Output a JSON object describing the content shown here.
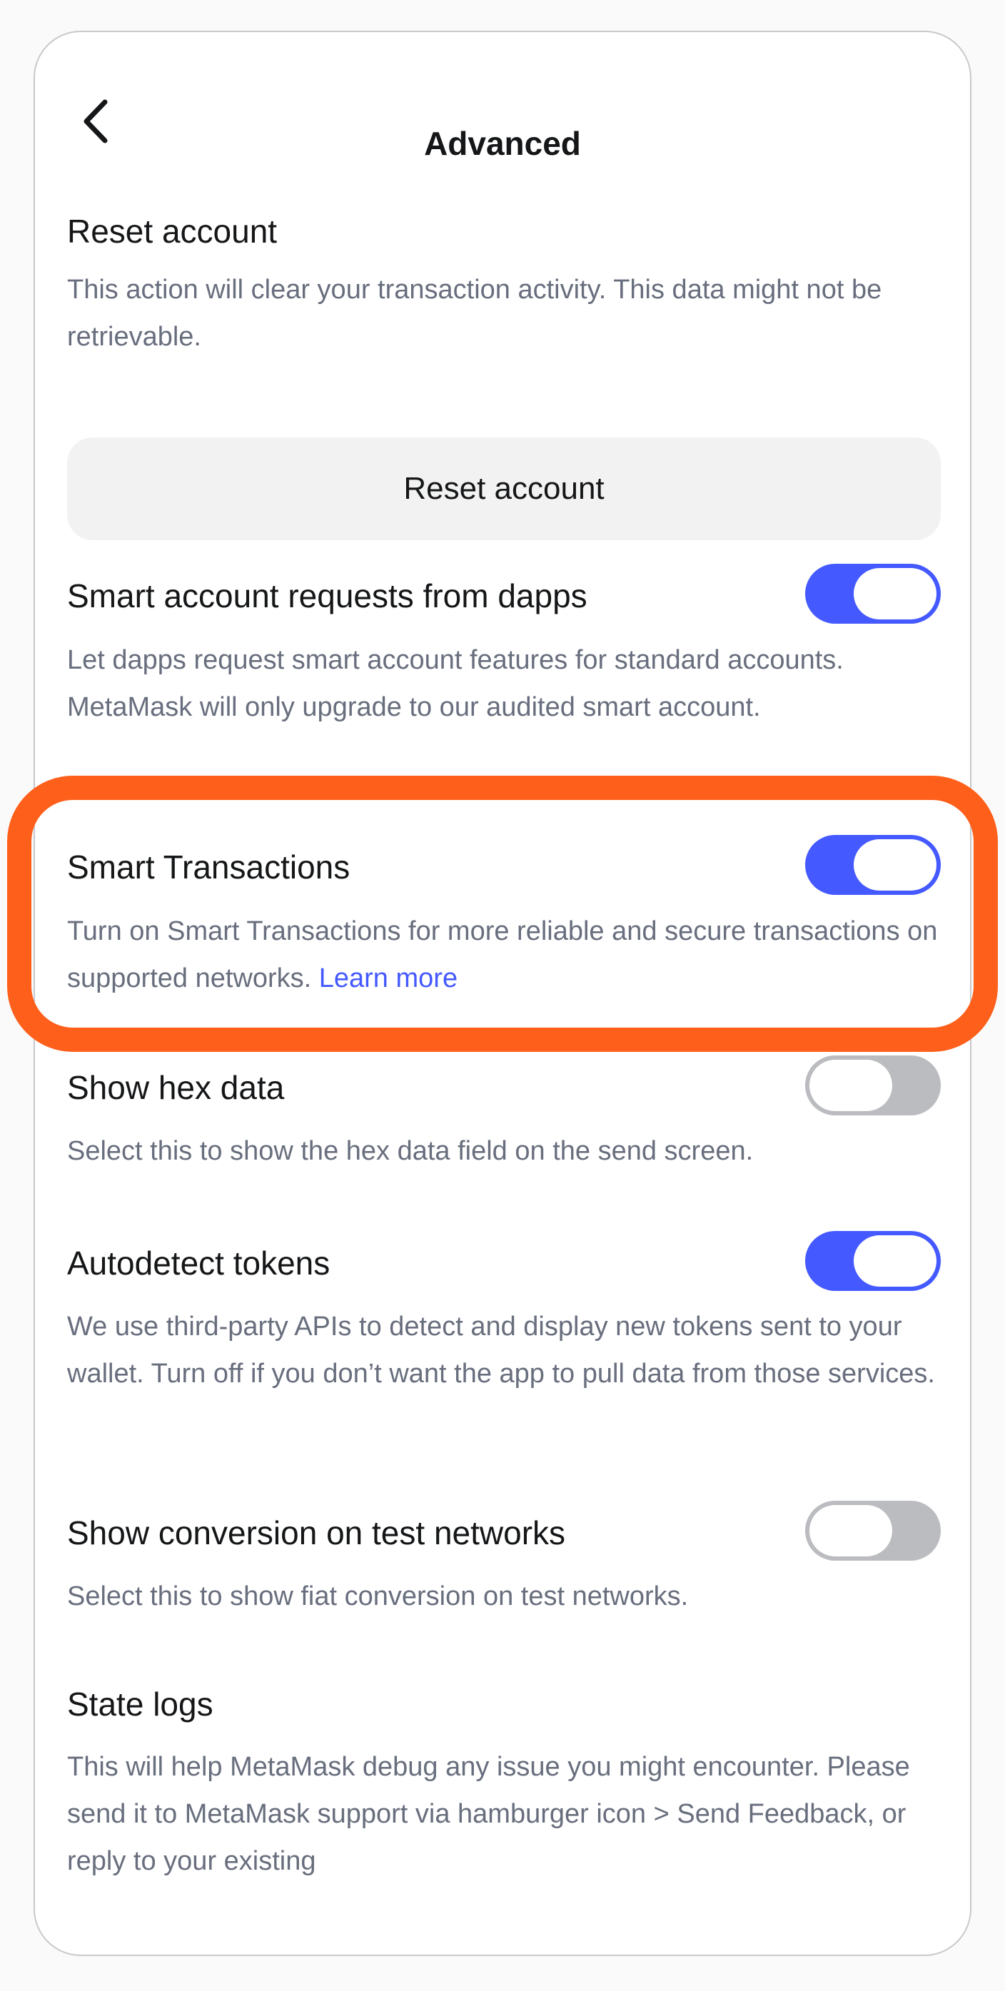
{
  "header": {
    "title": "Advanced",
    "back_icon": "chevron-left-icon"
  },
  "reset_account": {
    "title": "Reset account",
    "description": "This action will clear your transaction activity. This data might not be retrievable.",
    "button_label": "Reset account"
  },
  "smart_account_requests": {
    "title": "Smart account requests from dapps",
    "description": "Let dapps request smart account features for standard accounts. MetaMask will only upgrade to our audited smart account.",
    "enabled": true
  },
  "smart_transactions": {
    "title": "Smart Transactions",
    "description": "Turn on Smart Transactions for more reliable and secure transactions on supported networks.",
    "link_label": "Learn more",
    "enabled": true
  },
  "show_hex_data": {
    "title": "Show hex data",
    "description": "Select this to show the hex data field on the send screen.",
    "enabled": false
  },
  "autodetect_tokens": {
    "title": "Autodetect tokens",
    "description": "We use third-party APIs to detect and display new tokens sent to your wallet. Turn off if you don’t want the app to pull data from those services.",
    "enabled": true
  },
  "show_conversion_test_networks": {
    "title": "Show conversion on test networks",
    "description": "Select this to show fiat conversion on test networks.",
    "enabled": false
  },
  "state_logs": {
    "title": "State logs",
    "description": "This will help MetaMask debug any issue you might encounter. Please send it to MetaMask support via hamburger icon > Send Feedback, or reply to your existing"
  },
  "colors": {
    "accent": "#4459ff",
    "toggle_off": "#bbbcc0",
    "highlight": "#fe5f1b",
    "text_primary": "#141618",
    "text_secondary": "#686e7d"
  }
}
